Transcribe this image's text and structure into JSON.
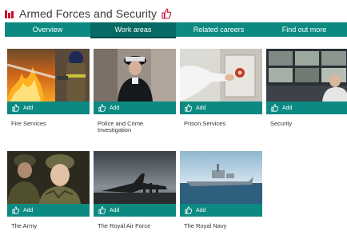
{
  "header": {
    "title": "Armed Forces and Security",
    "brand_color": "#c8102e"
  },
  "tabs": [
    {
      "label": "Overview",
      "active": false
    },
    {
      "label": "Work areas",
      "active": true
    },
    {
      "label": "Related careers",
      "active": false
    },
    {
      "label": "Find out more",
      "active": false
    }
  ],
  "accent_color": "#0c8a82",
  "cards": [
    {
      "label": "Fire Services",
      "add_label": "Add",
      "icon": "thumbs-up-icon"
    },
    {
      "label": "Police and Crime Investigation",
      "add_label": "Add",
      "icon": "thumbs-up-icon"
    },
    {
      "label": "Prison Services",
      "add_label": "Add",
      "icon": "thumbs-up-icon"
    },
    {
      "label": "Security",
      "add_label": "Add",
      "icon": "thumbs-up-icon"
    },
    {
      "label": "The Army",
      "add_label": "Add",
      "icon": "thumbs-up-icon"
    },
    {
      "label": "The Royal Air Force",
      "add_label": "Add",
      "icon": "thumbs-up-icon"
    },
    {
      "label": "The Royal Navy",
      "add_label": "Add",
      "icon": "thumbs-up-icon"
    }
  ]
}
